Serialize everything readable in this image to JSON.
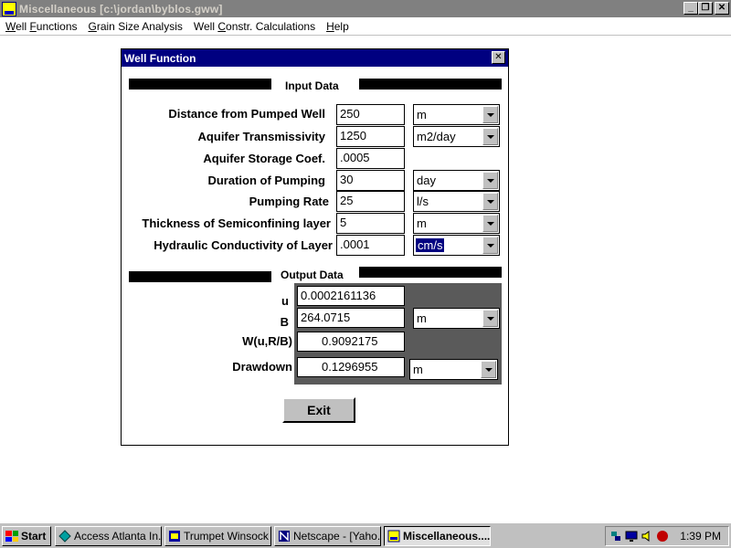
{
  "app": {
    "title": "Miscellaneous [c:\\jordan\\byblos.gww]"
  },
  "menu": {
    "items": [
      {
        "label_u": "W",
        "label_rest": "ell ",
        "label_u2": "F",
        "label_rest2": "unctions"
      },
      {
        "label_u": "G",
        "label_rest": "rain Size Analysis",
        "label_u2": "",
        "label_rest2": ""
      },
      {
        "label_u": "W",
        "label_rest": "ell ",
        "label_u2": "C",
        "label_rest2": "onstr. Calculations"
      },
      {
        "label_u": "H",
        "label_rest": "elp",
        "label_u2": "",
        "label_rest2": ""
      }
    ]
  },
  "dialog": {
    "title": "Well Function",
    "close_glyph": "✕",
    "input_title": "Input Data",
    "output_title": "Output Data",
    "inputs": [
      {
        "label": "Distance from Pumped Well",
        "value": "250",
        "unit": "m"
      },
      {
        "label": "Aquifer Transmissivity",
        "value": "1250",
        "unit": "m2/day"
      },
      {
        "label": "Aquifer Storage Coef.",
        "value": ".0005",
        "unit": ""
      },
      {
        "label": "Duration of Pumping",
        "value": "30",
        "unit": "day"
      },
      {
        "label": "Pumping Rate",
        "value": "25",
        "unit": "l/s"
      },
      {
        "label": "Thickness of Semiconfining layer",
        "value": "5",
        "unit": "m"
      },
      {
        "label": "Hydraulic Conductivity of Layer",
        "value": ".0001",
        "unit": "cm/s"
      }
    ],
    "outputs": {
      "u_label": "u",
      "u_value": "0.0002161136",
      "b_label": "B",
      "b_value": "264.0715",
      "b_unit": "m",
      "w_label": "W(u,R/B)",
      "w_value": "0.9092175",
      "drawdown_label": "Drawdown",
      "drawdown_value": "0.1296955",
      "drawdown_unit": "m"
    },
    "exit_label": "Exit"
  },
  "taskbar": {
    "start_label": "Start",
    "tasks": [
      {
        "label": "Access Atlanta In...",
        "icon": "network-icon"
      },
      {
        "label": "Trumpet Winsock",
        "icon": "winsock-icon"
      },
      {
        "label": "Netscape - [Yaho...",
        "icon": "netscape-icon"
      },
      {
        "label": "Miscellaneous....",
        "icon": "app-icon"
      }
    ],
    "clock": "1:39 PM"
  }
}
